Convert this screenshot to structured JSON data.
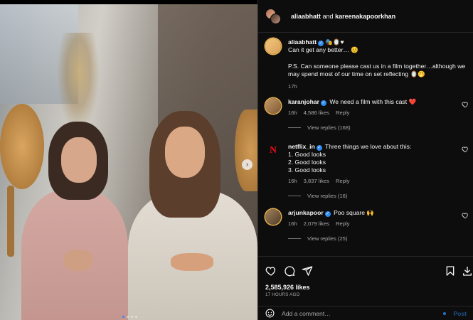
{
  "header": {
    "user1": "aliaabhatt",
    "conjunction": "and",
    "user2": "kareenakapoorkhan"
  },
  "caption": {
    "username": "aliaabhatt",
    "emojis": "🎭🪞♥",
    "line1": "Can it get any better… 😊",
    "line2": "P.S. Can someone please cast us in a film together…although we may spend most of our time on set reflecting 🪞🤭",
    "time": "17h"
  },
  "comments": [
    {
      "username": "karanjohar",
      "text": "We need a film with this cast ❤️",
      "time": "16h",
      "likes": "4,586 likes",
      "reply": "Reply",
      "view_replies": "View replies (168)"
    },
    {
      "username": "netflix_in",
      "text": "Three things we love about this:",
      "list": [
        "1. Good looks",
        "2. Good looks",
        "3. Good looks"
      ],
      "time": "16h",
      "likes": "3,837 likes",
      "reply": "Reply",
      "view_replies": "View replies (16)",
      "avatar_letter": "N"
    },
    {
      "username": "arjunkapoor",
      "text": "Poo square 🙌",
      "time": "16h",
      "likes": "2,079 likes",
      "reply": "Reply",
      "view_replies": "View replies (25)"
    }
  ],
  "actions": {
    "likes": "2,585,926 likes",
    "time_ago": "17 HOURS AGO"
  },
  "add_comment": {
    "placeholder": "Add a comment…",
    "post_label": "Post"
  },
  "carousel": {
    "next_glyph": "›",
    "slide_count": 4,
    "active_slide": 1
  },
  "colors": {
    "background": "#0d0d0d",
    "accent": "#2f8cf0",
    "muted": "#a8a8a8"
  }
}
